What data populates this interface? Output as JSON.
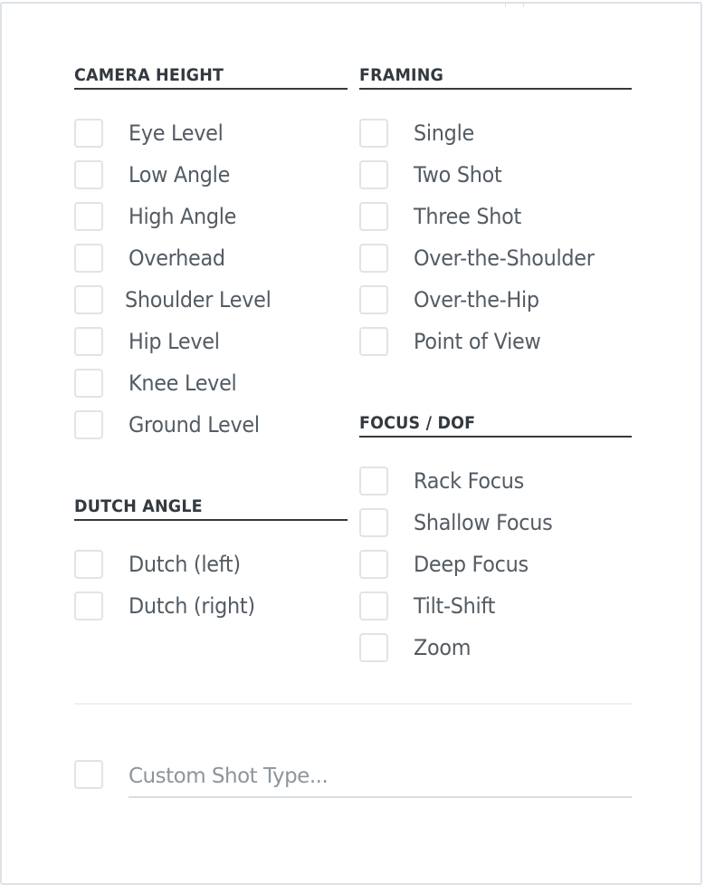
{
  "sections": {
    "camera_height": {
      "title": "CAMERA HEIGHT",
      "options": [
        {
          "label": "Eye Level",
          "checked": false
        },
        {
          "label": "Low Angle",
          "checked": false
        },
        {
          "label": "High Angle",
          "checked": false
        },
        {
          "label": "Overhead",
          "checked": false
        },
        {
          "label": "Shoulder Level",
          "checked": false
        },
        {
          "label": "Hip Level",
          "checked": false
        },
        {
          "label": "Knee Level",
          "checked": false
        },
        {
          "label": "Ground Level",
          "checked": false
        }
      ]
    },
    "dutch_angle": {
      "title": "DUTCH ANGLE",
      "options": [
        {
          "label": "Dutch (left)",
          "checked": false
        },
        {
          "label": "Dutch (right)",
          "checked": false
        }
      ]
    },
    "framing": {
      "title": "FRAMING",
      "options": [
        {
          "label": "Single",
          "checked": false
        },
        {
          "label": "Two Shot",
          "checked": false
        },
        {
          "label": "Three Shot",
          "checked": false
        },
        {
          "label": "Over-the-Shoulder",
          "checked": false
        },
        {
          "label": "Over-the-Hip",
          "checked": false
        },
        {
          "label": "Point of View",
          "checked": false
        }
      ]
    },
    "focus_dof": {
      "title": "FOCUS / DOF",
      "options": [
        {
          "label": "Rack Focus",
          "checked": false
        },
        {
          "label": "Shallow Focus",
          "checked": false
        },
        {
          "label": "Deep Focus",
          "checked": false
        },
        {
          "label": "Tilt-Shift",
          "checked": false
        },
        {
          "label": "Zoom",
          "checked": false
        }
      ]
    }
  },
  "custom": {
    "placeholder": "Custom Shot Type...",
    "value": "",
    "checked": false
  }
}
